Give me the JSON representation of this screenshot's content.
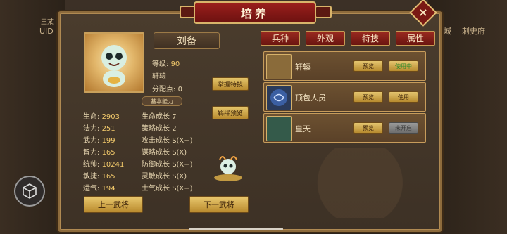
{
  "window": {
    "title": "培养",
    "close_label": "×"
  },
  "side": {
    "left_label": "UID",
    "left_top": "王某",
    "right_label_1": "城",
    "right_label_2": "刺史府"
  },
  "hero": {
    "name": "刘备",
    "level_label": "等级:",
    "level": "90",
    "specialty": "轩辕",
    "points_label": "分配点:",
    "points": "0",
    "buttons": {
      "master_skill": "掌握特技",
      "bond_preview": "羁绊预览"
    }
  },
  "section_basic": "基本能力",
  "stats": [
    {
      "name": "生命:",
      "value": "2903",
      "growth_name": "生命成长",
      "growth_value": "7"
    },
    {
      "name": "法力:",
      "value": "251",
      "growth_name": "策略成长",
      "growth_value": "2"
    },
    {
      "name": "武力:",
      "value": "199",
      "growth_name": "攻击成长",
      "growth_value": "S(X+)"
    },
    {
      "name": "智力:",
      "value": "165",
      "growth_name": "谋略成长",
      "growth_value": "S(X)"
    },
    {
      "name": "统帅:",
      "value": "10241",
      "growth_name": "防御成长",
      "growth_value": "S(X+)"
    },
    {
      "name": "敏捷:",
      "value": "165",
      "growth_name": "灵敏成长",
      "growth_value": "S(X)"
    },
    {
      "name": "运气:",
      "value": "194",
      "growth_name": "士气成长",
      "growth_value": "S(X+)"
    }
  ],
  "nav": {
    "prev": "上一武将",
    "next": "下一武将"
  },
  "tabs": [
    "兵种",
    "外观",
    "特技",
    "属性"
  ],
  "list": [
    {
      "name": "轩辕",
      "preview": "预览",
      "action": "使用中",
      "state": "active",
      "color": "#8a6b3a"
    },
    {
      "name": "顶包人员",
      "preview": "预览",
      "action": "使用",
      "state": "normal",
      "color": "#2b3b5a"
    },
    {
      "name": "皇天",
      "preview": "预览",
      "action": "未开启",
      "state": "locked",
      "color": "#345a4a"
    }
  ]
}
